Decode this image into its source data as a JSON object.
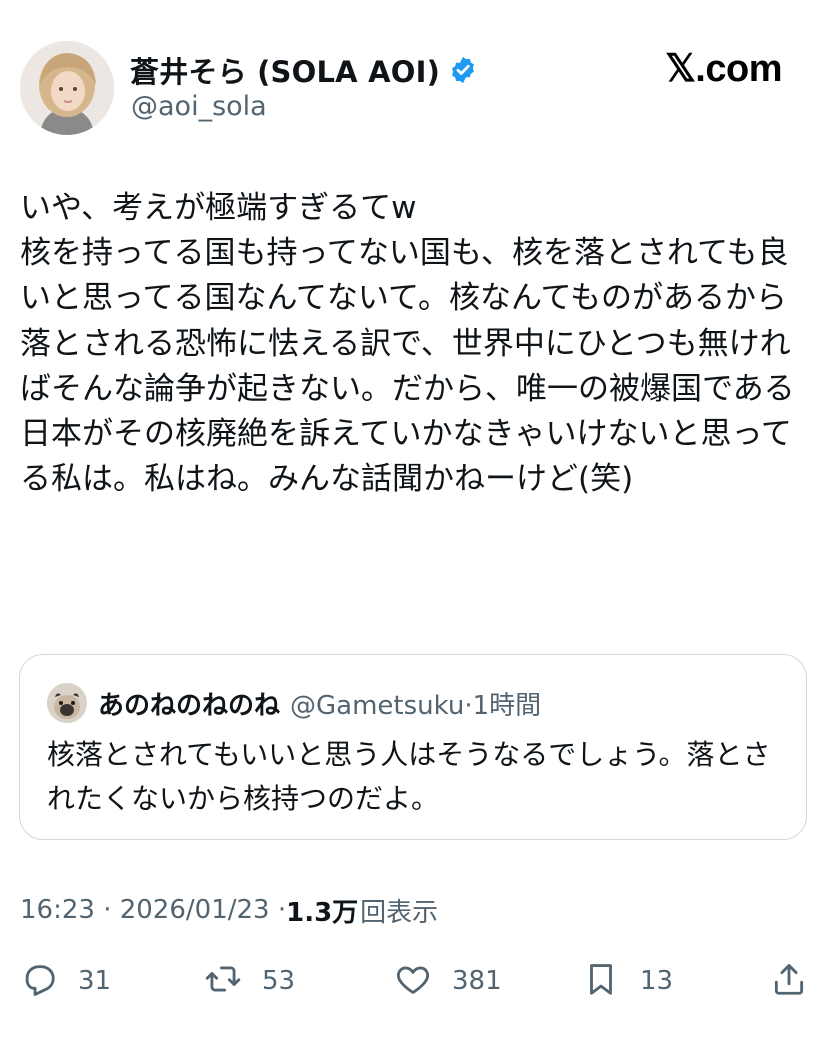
{
  "author": {
    "display_name": "蒼井そら (SOLA AOI)",
    "handle": "@aoi_sola",
    "verified_color": "#1d9bf0"
  },
  "brand": {
    "logo_text": "𝕏.com"
  },
  "tweet": {
    "text": "いや、考えが極端すぎるてw\n核を持ってる国も持ってない国も、核を落とされても良いと思ってる国なんてないて。核なんてものがあるから落とされる恐怖に怯える訳で、世界中にひとつも無ければそんな論争が起きない。だから、唯一の被爆国である日本がその核廃絶を訴えていかなきゃいけないと思ってる私は。私はね。みんな話聞かねーけど(笑)"
  },
  "quote": {
    "display_name": "あのねのねのね",
    "meta": "@Gametsuku·1時間",
    "text": "核落とされてもいいと思う人はそうなるでしょう。落とされたくないから核持つのだよ。"
  },
  "meta": {
    "time": "16:23 · 2026/01/23 · ",
    "views_count": "1.3万",
    "views_label": "回表示"
  },
  "actions": {
    "replies": "31",
    "reposts": "53",
    "likes": "381",
    "bookmarks": "13"
  },
  "colors": {
    "text": "#0f1419",
    "secondary": "#536471",
    "border": "#cfd9de"
  },
  "icons": [
    "verified-badge-icon",
    "reply-icon",
    "repost-icon",
    "like-icon",
    "bookmark-icon",
    "share-icon"
  ]
}
